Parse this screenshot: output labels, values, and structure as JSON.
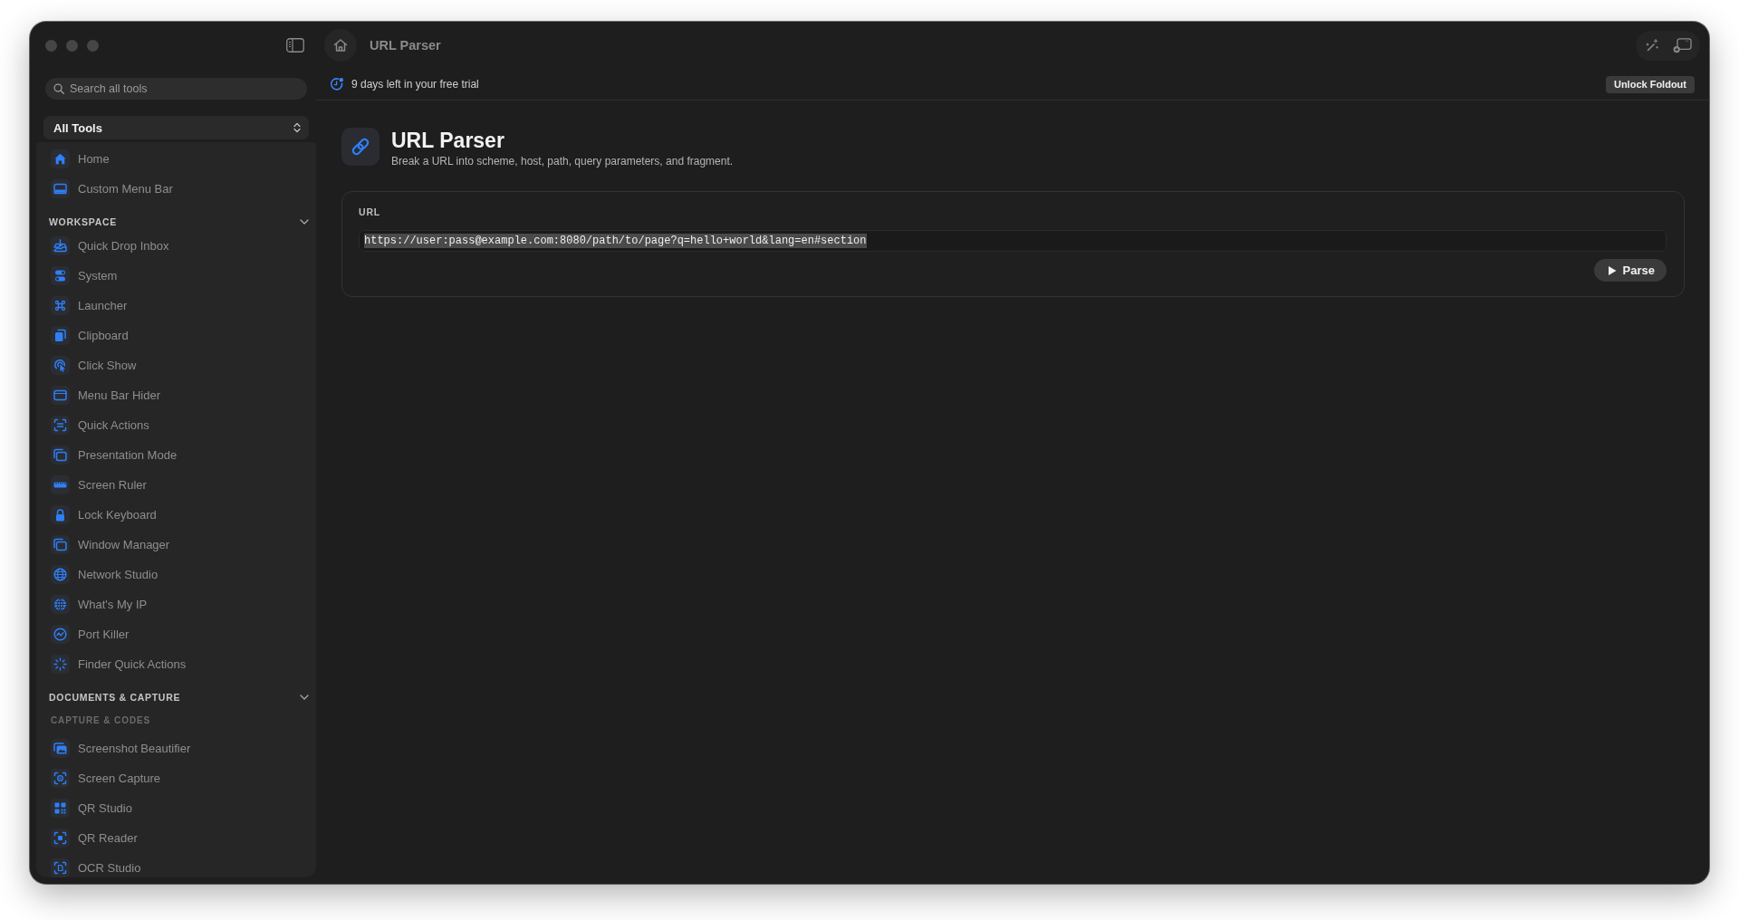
{
  "window": {
    "title": "URL Parser"
  },
  "sidebar": {
    "search": {
      "placeholder": "Search all tools"
    },
    "filter": {
      "value": "All Tools"
    },
    "pinned": [
      {
        "label": "Home",
        "selected": false
      },
      {
        "label": "Custom Menu Bar",
        "selected": false
      }
    ],
    "sections": [
      {
        "title": "WORKSPACE",
        "expanded": true,
        "groups": [
          {
            "items": [
              {
                "label": "Quick Drop Inbox",
                "selected": false
              },
              {
                "label": "System",
                "selected": false
              },
              {
                "label": "Launcher",
                "selected": false
              },
              {
                "label": "Clipboard",
                "selected": false
              },
              {
                "label": "Click Show",
                "selected": false
              },
              {
                "label": "Menu Bar Hider",
                "selected": false
              },
              {
                "label": "Quick Actions",
                "selected": false
              },
              {
                "label": "Presentation Mode",
                "selected": false
              },
              {
                "label": "Screen Ruler",
                "selected": false
              },
              {
                "label": "Lock Keyboard",
                "selected": false
              },
              {
                "label": "Window Manager",
                "selected": false
              },
              {
                "label": "Network Studio",
                "selected": false
              },
              {
                "label": "What's My IP",
                "selected": false
              },
              {
                "label": "Port Killer",
                "selected": false
              },
              {
                "label": "Finder Quick Actions",
                "selected": false
              }
            ]
          }
        ]
      },
      {
        "title": "DOCUMENTS & CAPTURE",
        "expanded": true,
        "groups": [
          {
            "title": "CAPTURE & CODES",
            "items": [
              {
                "label": "Screenshot Beautifier",
                "selected": false
              },
              {
                "label": "Screen Capture",
                "selected": false
              },
              {
                "label": "QR Studio",
                "selected": false
              },
              {
                "label": "QR Reader",
                "selected": false
              },
              {
                "label": "OCR Studio",
                "selected": false
              }
            ]
          }
        ]
      }
    ]
  },
  "trial_bar": {
    "message": "9 days left in your free trial",
    "button": "Unlock Foldout"
  },
  "page": {
    "title": "URL Parser",
    "subtitle": "Break a URL into scheme, host, path, query parameters, and fragment.",
    "url_input": {
      "label": "URL",
      "value": "https://user:pass@example.com:8080/path/to/page?q=hello+world&lang=en#section",
      "text_selected": true,
      "button": "Parse"
    }
  }
}
